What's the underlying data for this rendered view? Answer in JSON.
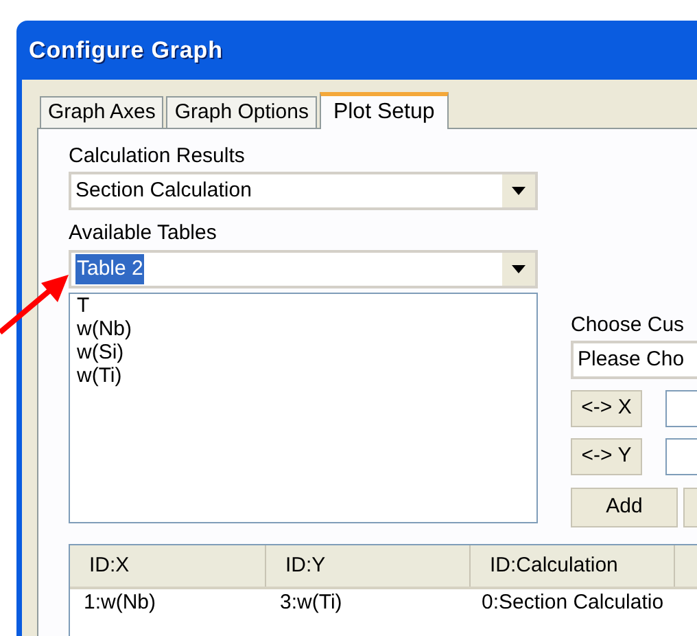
{
  "window": {
    "title": "Configure Graph"
  },
  "tabs": [
    {
      "label": "Graph Axes",
      "selected": false
    },
    {
      "label": "Graph Options",
      "selected": false
    },
    {
      "label": "Plot Setup",
      "selected": true
    }
  ],
  "calculation_results": {
    "label": "Calculation Results",
    "value": "Section Calculation"
  },
  "available_tables": {
    "label": "Available Tables",
    "value": "Table 2",
    "text_selected": true
  },
  "variables_list": [
    "T",
    "w(Nb)",
    "w(Si)",
    "w(Ti)"
  ],
  "custom": {
    "label": "Choose Cus",
    "value": "Please Cho"
  },
  "axis_buttons": [
    {
      "label": "<-> X"
    },
    {
      "label": "<-> Y"
    }
  ],
  "action_buttons": [
    {
      "label": "Add"
    }
  ],
  "plots_table": {
    "columns": [
      "ID:X",
      "ID:Y",
      "ID:Calculation"
    ],
    "rows": [
      [
        "1:w(Nb)",
        "3:w(Ti)",
        "0:Section Calculatio"
      ]
    ]
  }
}
